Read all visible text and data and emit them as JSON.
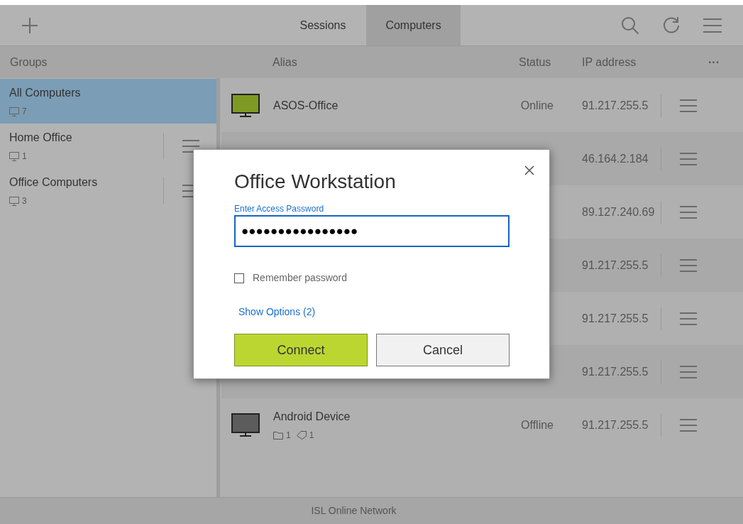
{
  "toolbar": {
    "tabs": [
      {
        "label": "Sessions",
        "selected": false
      },
      {
        "label": "Computers",
        "selected": true
      }
    ]
  },
  "sidebar": {
    "heading": "Groups",
    "items": [
      {
        "name": "All Computers",
        "count": "7",
        "selected": true,
        "has_menu": false
      },
      {
        "name": "Home Office",
        "count": "1",
        "selected": false,
        "has_menu": true
      },
      {
        "name": "Office Computers",
        "count": "3",
        "selected": false,
        "has_menu": true
      }
    ]
  },
  "table": {
    "columns": [
      "Alias",
      "Status",
      "IP address",
      "···"
    ],
    "rows": [
      {
        "alias": "ASOS-Office",
        "color": "#7f9a22",
        "status": "Online",
        "ip": "91.217.255.5"
      },
      {
        "ip": "46.164.2.184"
      },
      {
        "ip": "89.127.240.69"
      },
      {
        "ip": "91.217.255.5"
      },
      {
        "ip": "91.217.255.5"
      },
      {
        "ip": "91.217.255.5"
      },
      {
        "alias": "Android Device",
        "color": "#5c5c5c",
        "folders": "1",
        "tags": "1",
        "status": "Offline",
        "ip": "91.217.255.5"
      }
    ]
  },
  "dialog": {
    "title": "Office Workstation",
    "field_label": "Enter Access Password",
    "password": "●●●●●●●●●●●●●●●●",
    "remember": {
      "label": "Remember password",
      "checked": false
    },
    "link": "Show Options (2)",
    "buttons": [
      "Connect",
      "Cancel"
    ]
  },
  "status_bar": "ISL Online Network"
}
